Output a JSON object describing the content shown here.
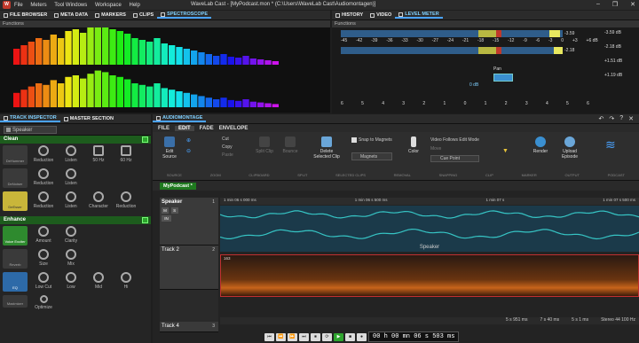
{
  "app": {
    "title": "WaveLab Cast - [MyPodcast.mon * (C:\\Users\\WaveLab Cast\\Audiomontagen)]",
    "menu": [
      "File",
      "Meters",
      "Tool Windows",
      "Workspace",
      "Help"
    ],
    "window_controls": [
      "–",
      "❐",
      "✕"
    ]
  },
  "left_top_tabs": [
    "FILE BROWSER",
    "META DATA",
    "MARKERS",
    "CLIPS",
    "SPECTROSCOPE"
  ],
  "right_top_tabs": [
    "HISTORY",
    "VIDEO",
    "LEVEL METER"
  ],
  "spectroscope": {
    "header": "Functions",
    "freq_labels": [
      "21Hz",
      "37Hz",
      "62Hz",
      "107Hz",
      "184Hz",
      "310Hz",
      "540Hz",
      "670Hz",
      "1.1kHz",
      "1.9kHz",
      "3.2kHz",
      "5.6kHz",
      "9.5kHz",
      "16kHz",
      "20kHz"
    ],
    "db_labels": [
      "0",
      "-6",
      "-12",
      "-18",
      "-24",
      "-30",
      "-36",
      "-42",
      "-48",
      "-54",
      "-60"
    ]
  },
  "level_meter": {
    "header": "Functions",
    "scale": [
      "-45",
      "-42",
      "-39",
      "-36",
      "-33",
      "-30",
      "-27",
      "-24",
      "-21",
      "-18",
      "-15",
      "-12",
      "-9",
      "-6",
      "-3",
      "0",
      "+3",
      "+6 dB"
    ],
    "peak_left": "-3.59",
    "peak_right": "-2.18",
    "pan_label": "Pan",
    "db0": "0 dB",
    "bottom_scale": [
      "6",
      "5",
      "4",
      "3",
      "2",
      "1",
      "0",
      "1",
      "2",
      "3",
      "4",
      "5",
      "6"
    ],
    "right_values": [
      "-3.59 dB",
      "-2.18 dB",
      "-18.20 dB",
      "-18.05 dB",
      "+1.51 dB",
      "+1.19 dB"
    ]
  },
  "inspector_tabs": [
    "TRACK INSPECTOR",
    "MASTER SECTION"
  ],
  "speaker_select": "Speaker",
  "clean": {
    "title": "Clean",
    "rows": [
      {
        "box": "DeHummer",
        "knobs": [
          "Reduction",
          "Listen",
          "50 Hz",
          "60 Hz"
        ]
      },
      {
        "box": "DeNoiser",
        "knobs": [
          "Reduction",
          "Listen"
        ]
      },
      {
        "box": "DeEsser",
        "knobs": [
          "Reduction",
          "Listen",
          "Character",
          "Reduction"
        ]
      }
    ]
  },
  "enhance": {
    "title": "Enhance",
    "rows": [
      {
        "box": "Voice Exciter",
        "knobs": [
          "Amount",
          "Clarity"
        ]
      },
      {
        "box": "Reverb",
        "knobs": [
          "Size",
          "Mix"
        ]
      },
      {
        "box": "EQ",
        "knobs": [
          "Low Cut",
          "Low",
          "Mid",
          "Hi"
        ]
      },
      {
        "box": "Maximizer",
        "knobs": [
          "Optimize"
        ]
      }
    ]
  },
  "audiomontage": {
    "title": "AUDIOMONTAGE",
    "tabs": [
      "FILE",
      "EDIT",
      "FADE",
      "ENVELOPE"
    ],
    "ribbon": {
      "edit_source": "Edit Source",
      "cut": "Cut",
      "copy": "Copy",
      "paste": "Paste",
      "split": "Split Clip",
      "bounce": "Bounce",
      "delete": "Delete Selected Clip",
      "snap": "Snap to Magnets",
      "magnets": "Magnets",
      "color": "Color",
      "video_follows": "Video Follows Edit Mode",
      "move": "Move",
      "cue_point": "Cue Point",
      "render": "Render",
      "upload": "Upload Episode",
      "groups": [
        "SOURCE",
        "ZOOM",
        "CLIPBOARD",
        "SPLIT",
        "SELECTED CLIPS",
        "REMOVAL",
        "SNAPPING",
        "CLIP",
        "MARKER",
        "OUTPUT",
        "PODCAST"
      ]
    },
    "doc_tab": "MyPodcast *",
    "ruler": [
      "0 s",
      "2 s",
      "4 s",
      "6 s",
      "8 s",
      "10 s",
      "12 s",
      "14 s",
      "16 s",
      "18 s"
    ],
    "ruler_sub": [
      "1 min 06 s 000 ms",
      "1 min 06 s 500 ms",
      "1 min 07 s",
      "1 min 07 s 500 ms"
    ],
    "tracks": [
      {
        "name": "Speaker",
        "num": "1",
        "clip": "Speaker"
      },
      {
        "name": "Track 2",
        "num": "2",
        "clip": "163"
      },
      {
        "name": "Track 4",
        "num": "3"
      }
    ],
    "track_buttons": [
      "M",
      "S",
      "IN"
    ],
    "status": [
      "5 s 951 ms",
      "7 s 40 ms",
      "5 s 951 ms",
      "5 s 1 ms",
      "Stereo 44 100 Hz"
    ],
    "timecode": "00 h 00 mn 06 s 503 ms",
    "transport": [
      "⏮",
      "⏪",
      "⏩",
      "⏭",
      "⏹",
      "⟳",
      "▶",
      "■",
      "●"
    ]
  }
}
